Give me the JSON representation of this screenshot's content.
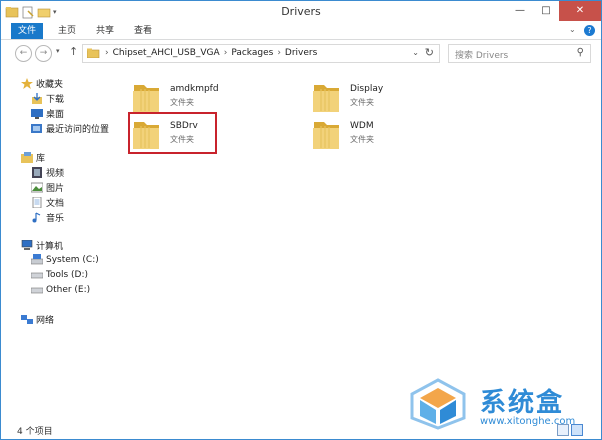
{
  "window": {
    "title": "Drivers"
  },
  "title_buttons": {
    "minimize": "—",
    "maximize": "□",
    "close": "✕"
  },
  "ribbon": {
    "tabs": [
      "文件",
      "主页",
      "共享",
      "查看"
    ]
  },
  "navigation": {
    "breadcrumbs": [
      "Chipset_AHCI_USB_VGA",
      "Packages",
      "Drivers"
    ],
    "search_placeholder": "搜索 Drivers"
  },
  "nav_pane": {
    "favorites": {
      "label": "收藏夹",
      "items": [
        "下载",
        "桌面",
        "最近访问的位置"
      ]
    },
    "libraries": {
      "label": "库",
      "items": [
        "视频",
        "图片",
        "文档",
        "音乐"
      ]
    },
    "computer": {
      "label": "计算机",
      "items": [
        "System (C:)",
        "Tools (D:)",
        "Other (E:)"
      ]
    },
    "network": {
      "label": "网络"
    }
  },
  "files": [
    {
      "name": "amdkmpfd",
      "type": "文件夹"
    },
    {
      "name": "Display",
      "type": "文件夹"
    },
    {
      "name": "SBDrv",
      "type": "文件夹",
      "highlighted": true
    },
    {
      "name": "WDM",
      "type": "文件夹"
    }
  ],
  "status": {
    "item_count": "4 个项目"
  },
  "watermark": {
    "brand": "系统盒",
    "url": "www.xitonghe.com"
  },
  "colors": {
    "accent": "#1979ca",
    "highlight_border": "#c8232c",
    "folder": "#e8c35a",
    "watermark": "#2f8bd6"
  }
}
